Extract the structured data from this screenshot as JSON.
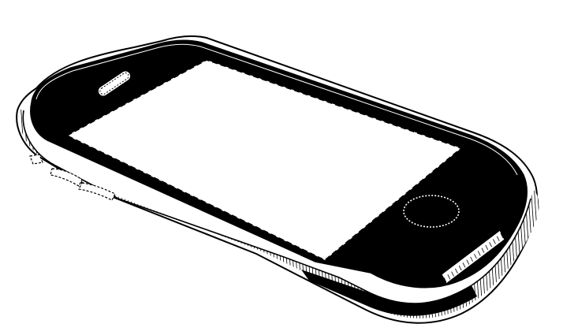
{
  "figure": {
    "kind": "patent-style line drawing",
    "subject": "smartphone-perspective-view",
    "colors": {
      "line": "#000000",
      "fill": "#ffffff",
      "bezel": "#000000"
    }
  }
}
